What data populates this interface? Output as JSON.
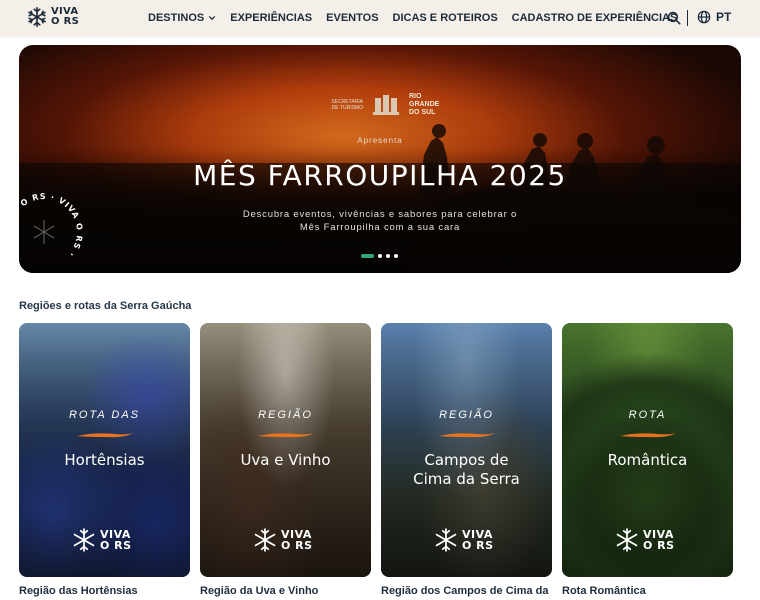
{
  "header": {
    "logo": {
      "line1": "VIVA",
      "line2": "O RS",
      "icon": "snowflake-logo-icon"
    },
    "nav": [
      {
        "label": "DESTINOS",
        "has_dropdown": true
      },
      {
        "label": "EXPERIÊNCIAS"
      },
      {
        "label": "EVENTOS"
      },
      {
        "label": "DICAS E ROTEIROS"
      },
      {
        "label": "CADASTRO DE EXPERIÊNCIAS"
      }
    ],
    "search_icon": "search-icon",
    "language": {
      "label": "PT",
      "icon": "globe-icon"
    }
  },
  "hero": {
    "sponsor": {
      "left": "SECRETARIA DE TURISMO",
      "right_line1": "RIO",
      "right_line2": "GRANDE",
      "right_line3": "DO SUL"
    },
    "kicker": "Apresenta",
    "title": "MÊS FARROUPILHA 2025",
    "subtitle_line1": "Descubra eventos, vivências e sabores para celebrar o",
    "subtitle_line2": "Mês Farroupilha com a sua cara",
    "badge_text": "VIVA O RS · VIVA O RS ·",
    "slides": 4,
    "active_slide": 1
  },
  "section": {
    "title": "Regiões e rotas da Serra Gaúcha",
    "cards": [
      {
        "kicker": "ROTA DAS",
        "name": "Hortênsias",
        "label": "Região das Hortênsias",
        "logo_line1": "VIVA",
        "logo_line2": "O RS"
      },
      {
        "kicker": "REGIÃO",
        "name": "Uva e Vinho",
        "label": "Região da Uva e Vinho",
        "logo_line1": "VIVA",
        "logo_line2": "O RS"
      },
      {
        "kicker": "REGIÃO",
        "name": "Campos de Cima da Serra",
        "name_line1": "Campos de",
        "name_line2": "Cima da Serra",
        "label": "Região dos Campos de Cima da",
        "logo_line1": "VIVA",
        "logo_line2": "O RS"
      },
      {
        "kicker": "ROTA",
        "name": "Romântica",
        "label": "Rota Romântica",
        "logo_line1": "VIVA",
        "logo_line2": "O RS"
      }
    ]
  },
  "colors": {
    "header_bg": "#f4efe8",
    "accent_green": "#2fae7a",
    "stroke_orange": "#e8731f",
    "text_dark": "#1c2b3a"
  }
}
